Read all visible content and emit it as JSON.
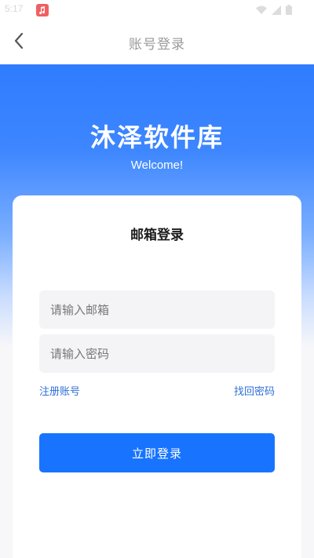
{
  "status_bar": {
    "time": "5:17",
    "icons": [
      "music-app-icon",
      "wifi-icon",
      "signal-icon",
      "battery-icon"
    ]
  },
  "nav": {
    "title": "账号登录",
    "back_icon": "chevron-left-icon"
  },
  "hero": {
    "title": "沐泽软件库",
    "subtitle": "Welcome!"
  },
  "login_card": {
    "title": "邮箱登录",
    "email": {
      "value": "",
      "placeholder": "请输入邮箱"
    },
    "password": {
      "value": "",
      "placeholder": "请输入密码"
    },
    "register_link": "注册账号",
    "forgot_link": "找回密码",
    "submit_label": "立即登录"
  },
  "colors": {
    "primary": "#1874ff",
    "link": "#2e6fd8",
    "hero_top": "#2f7cff",
    "background": "#f7f7f9"
  }
}
